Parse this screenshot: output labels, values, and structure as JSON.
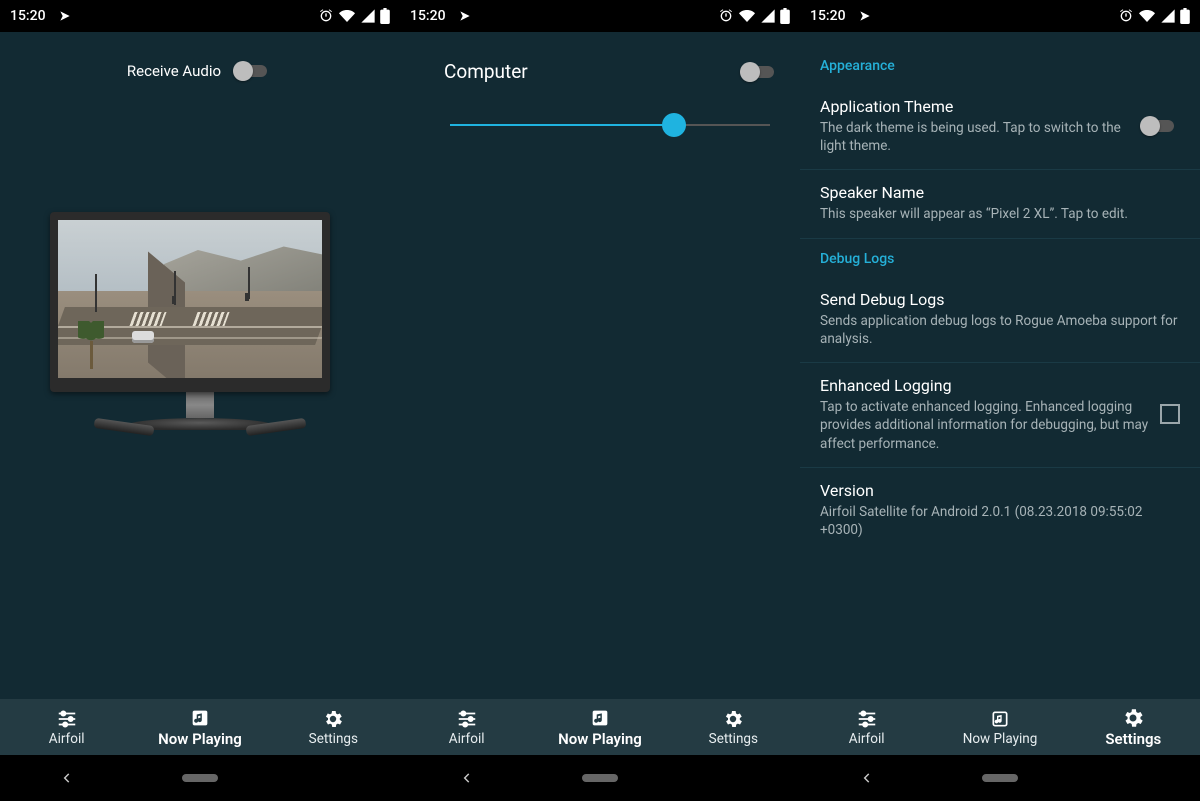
{
  "statusbar": {
    "time": "15:20"
  },
  "tabs": {
    "airfoil": "Airfoil",
    "now_playing": "Now Playing",
    "settings": "Settings"
  },
  "screen1": {
    "receive_audio_label": "Receive Audio",
    "receive_audio_on": false
  },
  "screen2": {
    "device_label": "Computer",
    "device_toggle_on": false,
    "volume_percent": 70
  },
  "screen3": {
    "sections": {
      "appearance": "Appearance",
      "debug_logs": "Debug Logs"
    },
    "theme": {
      "title": "Application Theme",
      "subtitle": "The dark theme is being used. Tap to switch to the light theme.",
      "on": false
    },
    "speaker": {
      "title": "Speaker Name",
      "subtitle": "This speaker will appear as “Pixel 2 XL”. Tap to edit."
    },
    "send_logs": {
      "title": "Send Debug Logs",
      "subtitle": "Sends application debug logs to Rogue Amoeba support for analysis."
    },
    "enhanced": {
      "title": "Enhanced Logging",
      "subtitle": "Tap to activate enhanced logging. Enhanced logging provides additional information for debugging, but may affect performance.",
      "checked": false
    },
    "version": {
      "title": "Version",
      "subtitle": "Airfoil Satellite for Android 2.0.1 (08.23.2018 09:55:02 +0300)"
    }
  }
}
